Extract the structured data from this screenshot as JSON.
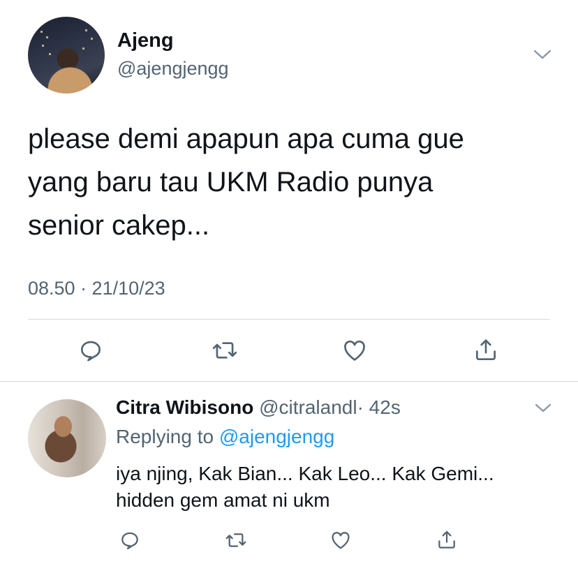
{
  "main_tweet": {
    "author_name": "Ajeng",
    "author_handle": "@ajengjengg",
    "text": "please demi apapun apa cuma gue\nyang baru tau UKM Radio punya\nsenior cakep...",
    "timestamp": "08.50 · 21/10/23",
    "actions": [
      "reply-icon",
      "retweet-icon",
      "like-icon",
      "share-icon"
    ]
  },
  "reply": {
    "author_name": "Citra Wibisono",
    "author_handle": "@citralandl",
    "age": "· 42s",
    "replying_prefix": "Replying to",
    "replying_handle": "@ajengjengg",
    "text": "iya njing, Kak Bian... Kak Leo... Kak Gemi...\nhidden gem amat ni ukm",
    "actions": [
      "reply-icon",
      "retweet-icon",
      "like-icon",
      "share-icon"
    ]
  },
  "colors": {
    "text": "#0f1419",
    "secondary": "#536471",
    "link": "#1d9bf0",
    "divider": "#d6d9db"
  }
}
